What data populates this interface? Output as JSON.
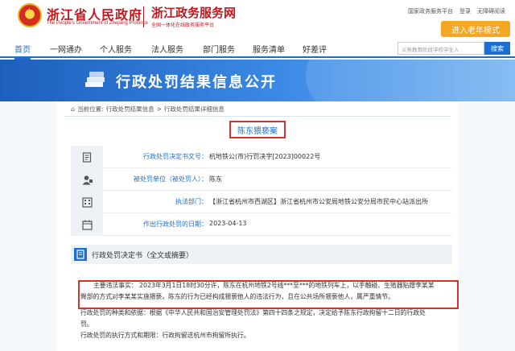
{
  "header": {
    "gov_name": "浙江省人民政府",
    "gov_sub": "The People's Government of Zhejiang Province",
    "service_name": "浙江政务服务网",
    "service_sub": "全国一体化在线政务服务平台",
    "links": [
      "国家政务服务平台",
      "登录",
      "无障碍阅读"
    ],
    "elder_mode": "进入老年模式"
  },
  "nav": {
    "items": [
      "首页",
      "一网通办",
      "个人服务",
      "法人服务",
      "部门服务",
      "服务清单",
      "好差评"
    ],
    "search_placeholder": "义务教育阶段学校学生入",
    "search_button": "搜索"
  },
  "banner": {
    "title": "行政处罚结果信息公开"
  },
  "breadcrumb": {
    "prefix": "当前位置:",
    "items": [
      "行政处罚结果信息",
      "行政处罚结果详细信息"
    ],
    "sep": ">"
  },
  "case": {
    "title": "陈东猥亵案",
    "rows": [
      {
        "label": "行政处罚决定书文号：",
        "value": "杭地铁公(市)行罚决字[2023]00022号"
      },
      {
        "label": "被处罚单位（被处罚人）：",
        "value": "陈东"
      },
      {
        "label": "执法部门：",
        "value": "【浙江省杭州市西湖区】浙江省杭州市公安局地铁公安分局市民中心站派出所"
      },
      {
        "label": "作出行政处罚的日期：",
        "value": "2023-04-13"
      }
    ]
  },
  "decision": {
    "title": "行政处罚决定书（全文或摘要）",
    "lines": [
      "主要违法事实：  2023年3月1日18时30分许，陈东在杭州地铁2号线***至***的地铁列车上，以手触碰、生殖器贴蹭李某某",
      "臀部的方式对李某某实施猥亵。陈东的行为已经构成猥亵他人的违法行为，且在公共场所猥亵他人，属严重情节。",
      "行政处罚的种类和依据：根据《中华人民共和国治安管理处罚法》第四十四条之规定，决定给予陈东行政拘留十二日的行政处",
      "罚。",
      "行政处罚的执行方式和期限：行政拘留送杭州市拘留所执行。"
    ]
  }
}
